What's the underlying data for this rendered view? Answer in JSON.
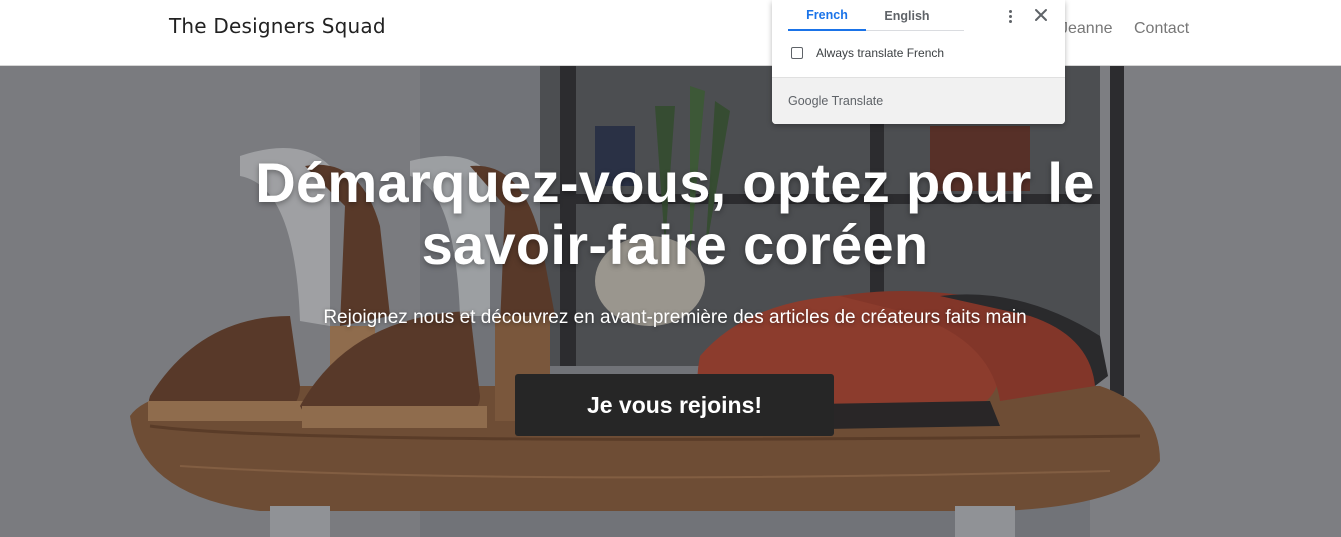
{
  "header": {
    "brand": "The Designers Squad",
    "nav": [
      {
        "label": "Jeanne"
      },
      {
        "label": "Contact"
      }
    ]
  },
  "hero": {
    "title": "Démarquez-vous, optez pour le savoir-faire coréen",
    "subtitle": "Rejoignez nous et découvrez en avant-première des articles de créateurs faits main",
    "cta_label": "Je vous rejoins!"
  },
  "translate_popup": {
    "tabs": [
      {
        "label": "French",
        "active": true
      },
      {
        "label": "English",
        "active": false
      }
    ],
    "checkbox_label": "Always translate French",
    "checkbox_checked": false,
    "footer_brand": "Google",
    "footer_product": "Translate",
    "icons": [
      "more-vert-icon",
      "close-icon"
    ],
    "accent_color": "#1a73e8"
  },
  "colors": {
    "cta_background": "#262626",
    "hero_text": "#ffffff",
    "nav_text": "#777777"
  }
}
